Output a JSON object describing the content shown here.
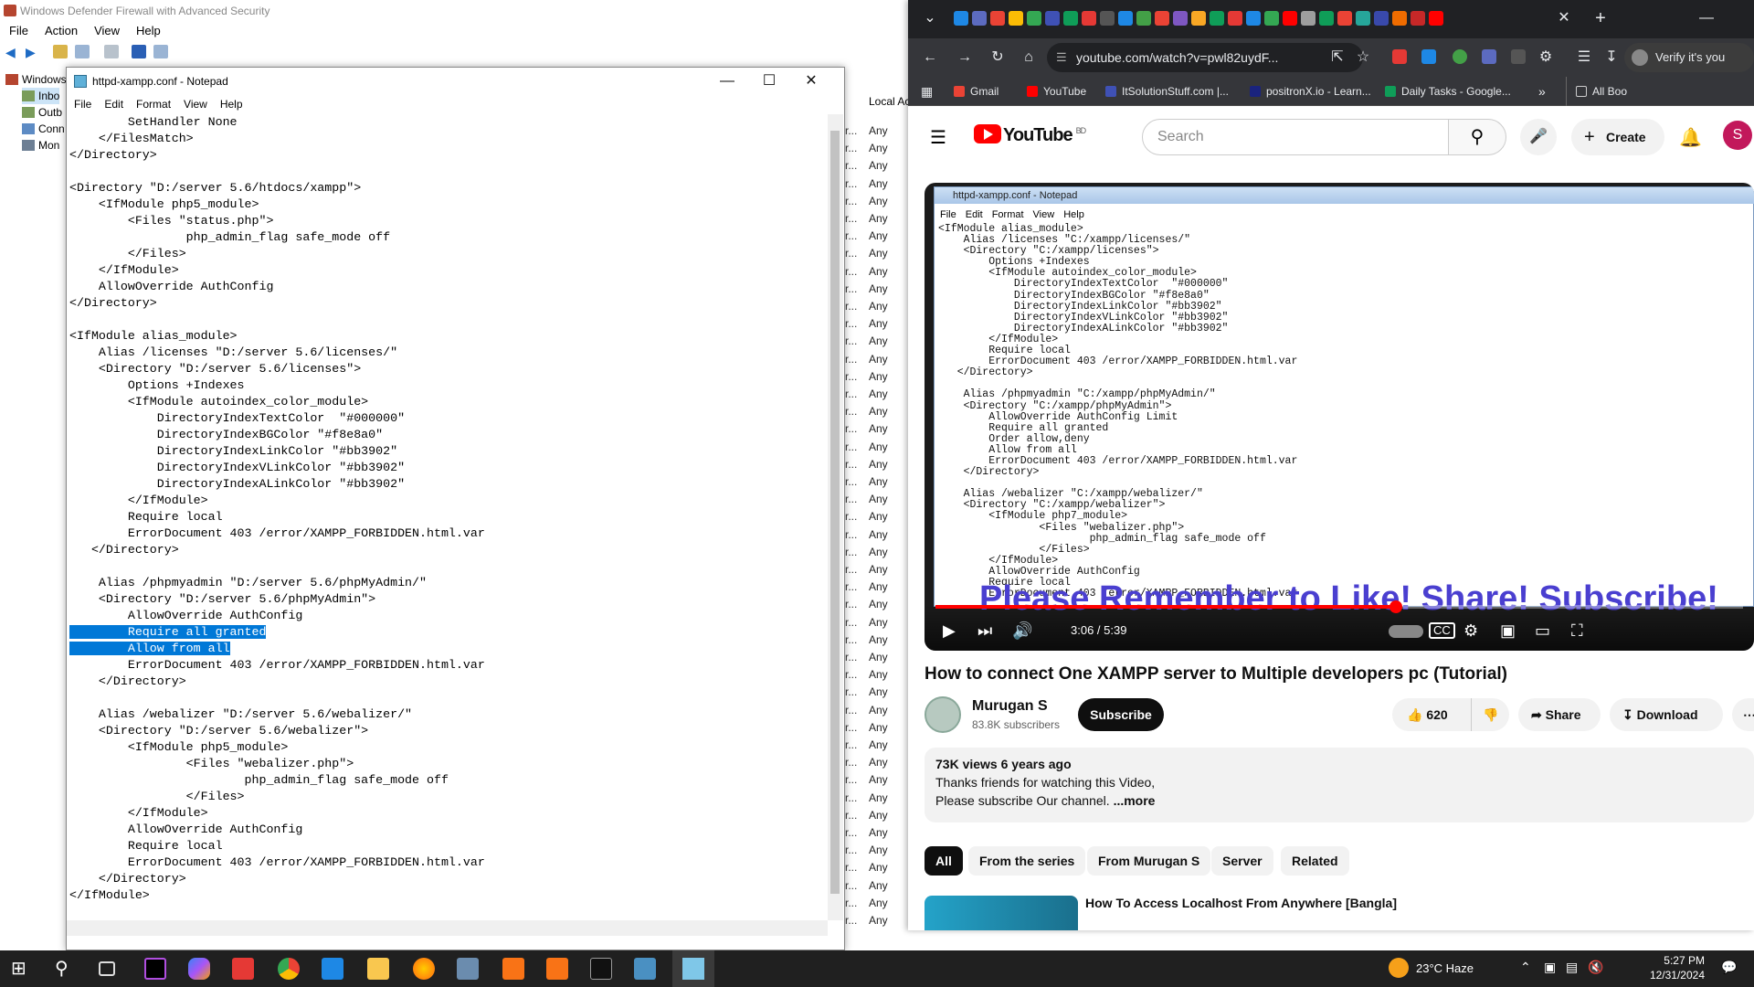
{
  "firewall": {
    "title": "Windows Defender Firewall with Advanced Security",
    "menu": [
      "File",
      "Action",
      "View",
      "Help"
    ],
    "tree": [
      "Windows",
      "Inbo",
      "Outb",
      "Conn",
      "Mon"
    ],
    "col_header": "Local Ac",
    "any": "Any"
  },
  "notepad": {
    "title": "httpd-xampp.conf - Notepad",
    "menu": [
      "File",
      "Edit",
      "Format",
      "View",
      "Help"
    ],
    "lines": [
      "        SetHandler None",
      "    </FilesMatch>",
      "</Directory>",
      "",
      "<Directory \"D:/server 5.6/htdocs/xampp\">",
      "    <IfModule php5_module>",
      "        <Files \"status.php\">",
      "                php_admin_flag safe_mode off",
      "        </Files>",
      "    </IfModule>",
      "    AllowOverride AuthConfig",
      "</Directory>",
      "",
      "<IfModule alias_module>",
      "    Alias /licenses \"D:/server 5.6/licenses/\"",
      "    <Directory \"D:/server 5.6/licenses\">",
      "        Options +Indexes",
      "        <IfModule autoindex_color_module>",
      "            DirectoryIndexTextColor  \"#000000\"",
      "            DirectoryIndexBGColor \"#f8e8a0\"",
      "            DirectoryIndexLinkColor \"#bb3902\"",
      "            DirectoryIndexVLinkColor \"#bb3902\"",
      "            DirectoryIndexALinkColor \"#bb3902\"",
      "        </IfModule>",
      "        Require local",
      "        ErrorDocument 403 /error/XAMPP_FORBIDDEN.html.var",
      "   </Directory>",
      "",
      "    Alias /phpmyadmin \"D:/server 5.6/phpMyAdmin/\"",
      "    <Directory \"D:/server 5.6/phpMyAdmin\">",
      "        AllowOverride AuthConfig",
      "        Require all granted",
      "        Allow from all",
      "        ErrorDocument 403 /error/XAMPP_FORBIDDEN.html.var",
      "    </Directory>",
      "",
      "    Alias /webalizer \"D:/server 5.6/webalizer/\"",
      "    <Directory \"D:/server 5.6/webalizer\">",
      "        <IfModule php5_module>",
      "                <Files \"webalizer.php\">",
      "                        php_admin_flag safe_mode off",
      "                </Files>",
      "        </IfModule>",
      "        AllowOverride AuthConfig",
      "        Require local",
      "        ErrorDocument 403 /error/XAMPP_FORBIDDEN.html.var",
      "    </Directory>",
      "</IfModule>"
    ]
  },
  "chrome": {
    "url": "youtube.com/watch?v=pwl82uydF...",
    "profile": "Verify it's you",
    "bookmarks": [
      "Gmail",
      "YouTube",
      "ItSolutionStuff.com |...",
      "positronX.io - Learn...",
      "Daily Tasks - Google...",
      "All Boo"
    ]
  },
  "youtube": {
    "search_placeholder": "Search",
    "create": "Create",
    "avatar": "S",
    "logo": "YouTube",
    "country": "BD",
    "video": {
      "np_title": "httpd-xampp.conf - Notepad",
      "np_menu": [
        "File",
        "Edit",
        "Format",
        "View",
        "Help"
      ],
      "lines": [
        "<IfModule alias_module>",
        "    Alias /licenses \"C:/xampp/licenses/\"",
        "    <Directory \"C:/xampp/licenses\">",
        "        Options +Indexes",
        "        <IfModule autoindex_color_module>",
        "            DirectoryIndexTextColor  \"#000000\"",
        "            DirectoryIndexBGColor \"#f8e8a0\"",
        "            DirectoryIndexLinkColor \"#bb3902\"",
        "            DirectoryIndexVLinkColor \"#bb3902\"",
        "            DirectoryIndexALinkColor \"#bb3902\"",
        "        </IfModule>",
        "        Require local",
        "        ErrorDocument 403 /error/XAMPP_FORBIDDEN.html.var",
        "   </Directory>",
        "",
        "    Alias /phpmyadmin \"C:/xampp/phpMyAdmin/\"",
        "    <Directory \"C:/xampp/phpMyAdmin\">",
        "        AllowOverride AuthConfig Limit",
        "        Require all granted",
        "        Order allow,deny",
        "        Allow from all",
        "        ErrorDocument 403 /error/XAMPP_FORBIDDEN.html.var",
        "    </Directory>",
        "",
        "    Alias /webalizer \"C:/xampp/webalizer/\"",
        "    <Directory \"C:/xampp/webalizer\">",
        "        <IfModule php7_module>",
        "                <Files \"webalizer.php\">",
        "                        php_admin_flag safe_mode off",
        "                </Files>",
        "        </IfModule>",
        "        AllowOverride AuthConfig",
        "        Require local",
        "        ErrorDocument 403 /error/XAMPP_FORBIDDEN.html.var"
      ],
      "overlay": "Please Remember to Like! Share! Subscribe!",
      "time": "3:06 / 5:39",
      "progress": 0.57
    },
    "title": "How to connect One XAMPP server to Multiple developers pc (Tutorial)",
    "channel": {
      "name": "Murugan S",
      "subs": "83.8K subscribers",
      "subscribe": "Subscribe"
    },
    "likes": "620",
    "share": "Share",
    "download": "Download",
    "desc": {
      "stats": "73K views  6 years ago",
      "line1": "Thanks friends for watching this Video,",
      "line2": "Please subscribe Our channel.",
      "more": "...more"
    },
    "chips": [
      "All",
      "From the series",
      "From Murugan S",
      "Server",
      "Related"
    ],
    "related_title": "How To Access Localhost From Anywhere [Bangla]"
  },
  "taskbar": {
    "weather": "23°C  Haze",
    "time": "5:27 PM",
    "date": "12/31/2024"
  }
}
